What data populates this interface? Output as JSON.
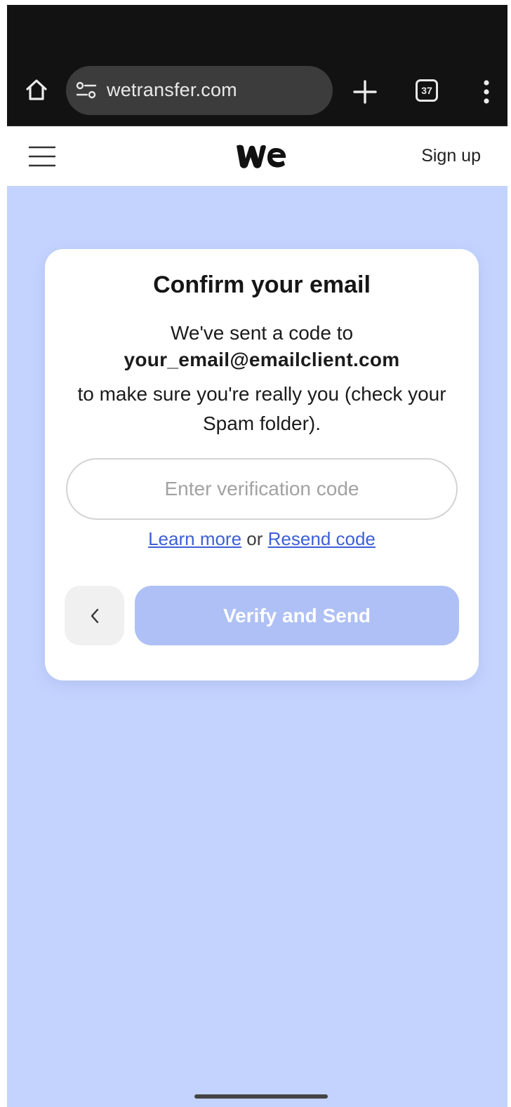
{
  "browser": {
    "url": "wetransfer.com",
    "tab_count": "37"
  },
  "site_header": {
    "signup_label": "Sign up"
  },
  "card": {
    "title": "Confirm your email",
    "sent_line": "We've sent a code to",
    "email": "your_email@emailclient.com",
    "check_line": "to make sure you're really you (check your Spam folder).",
    "code_placeholder": "Enter verification code",
    "learn_more_label": "Learn more",
    "or_label": "or",
    "resend_label": "Resend code",
    "back_icon": "chevron-left-icon",
    "verify_label": "Verify and Send"
  },
  "colors": {
    "page_background": "#c4d3fe",
    "verify_button": "#aec0f5",
    "link": "#3d5fd6",
    "chrome_background": "#121212"
  }
}
